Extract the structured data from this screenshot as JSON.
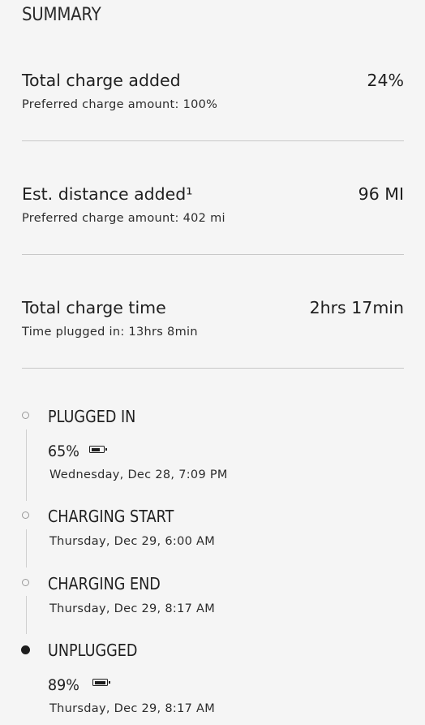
{
  "summary": {
    "title": "SUMMARY",
    "rows": [
      {
        "label": "Total charge added",
        "value": "24%",
        "sub": "Preferred charge amount: 100%"
      },
      {
        "label": "Est. distance added¹",
        "value": "96 MI",
        "sub": "Preferred charge amount: 402 mi"
      },
      {
        "label": "Total charge time",
        "value": "2hrs 17min",
        "sub": "Time plugged in: 13hrs 8min"
      }
    ]
  },
  "timeline": {
    "events": [
      {
        "title": "PLUGGED IN",
        "level": "65%",
        "battery_fraction": 0.65,
        "time": "Wednesday, Dec 28, 7:09 PM",
        "dot": "hollow"
      },
      {
        "title": "CHARGING START",
        "time": "Thursday, Dec 29, 6:00 AM",
        "dot": "hollow"
      },
      {
        "title": "CHARGING END",
        "time": "Thursday, Dec 29, 8:17 AM",
        "dot": "hollow"
      },
      {
        "title": "UNPLUGGED",
        "level": "89%",
        "battery_fraction": 0.89,
        "time": "Thursday, Dec 29, 8:17 AM",
        "dot": "filled"
      }
    ]
  },
  "icons": {
    "battery": "battery-icon",
    "timeline_dot": "timeline-dot-icon"
  },
  "colors": {
    "background": "#f5f5f5",
    "text": "#1e1e1e",
    "divider": "#c8c8c8"
  }
}
